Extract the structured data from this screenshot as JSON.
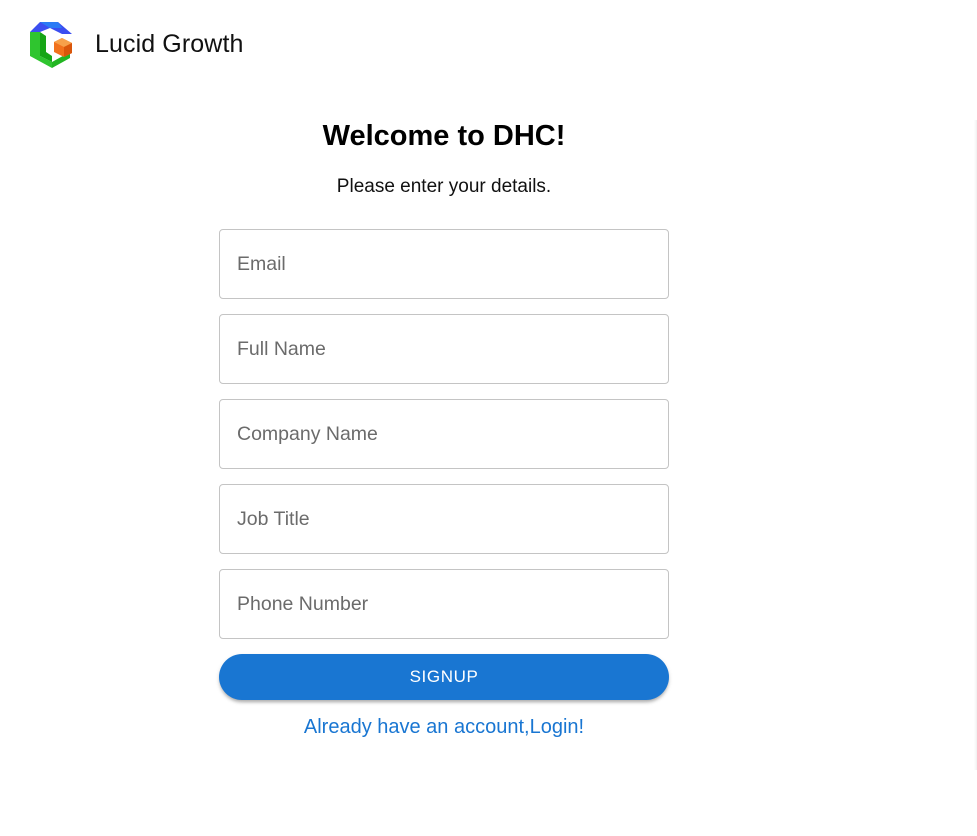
{
  "header": {
    "brand_name": "Lucid Growth",
    "logo_icon": "lucid-growth-logo-icon"
  },
  "form": {
    "title": "Welcome to DHC!",
    "subtitle": "Please enter your details.",
    "fields": [
      {
        "placeholder": "Email",
        "value": ""
      },
      {
        "placeholder": "Full Name",
        "value": ""
      },
      {
        "placeholder": "Company Name",
        "value": ""
      },
      {
        "placeholder": "Job Title",
        "value": ""
      },
      {
        "placeholder": "Phone Number",
        "value": ""
      }
    ],
    "submit_label": "SIGNUP",
    "login_link": "Already have an account,Login!"
  },
  "colors": {
    "primary": "#1976d2",
    "input_border": "#c4c4c4",
    "placeholder_text": "#6b6b6b",
    "logo_blue": "#3f51f5",
    "logo_green": "#2ecc2e",
    "logo_orange": "#f57c1f"
  }
}
